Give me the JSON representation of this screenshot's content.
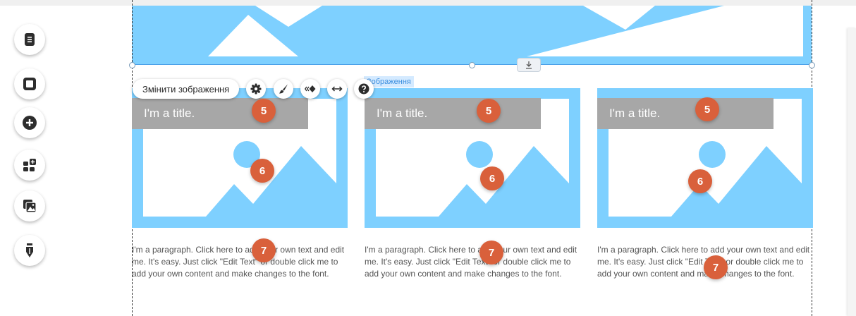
{
  "toolbar": {
    "change_image_label": "Змінити зображення",
    "image_tag": "Зображення",
    "icons": [
      "gear-icon",
      "brush-icon",
      "animation-icon",
      "stretch-icon",
      "help-icon"
    ]
  },
  "left_tools": [
    "pages-icon",
    "background-icon",
    "add-icon",
    "app-market-icon",
    "media-icon",
    "blog-icon"
  ],
  "cards": [
    {
      "title": "I'm a title.",
      "paragraph": "I'm a paragraph. Click here to add your own text and edit me. It's easy. Just click \"Edit Text\" or double click me to add your own content and make changes to the font."
    },
    {
      "title": "I'm a title.",
      "paragraph": "I'm a paragraph. Click here to add your own text and edit me. It's easy. Just click \"Edit Text\" or double click me to add your own content and make changes to the font."
    },
    {
      "title": "I'm a title.",
      "paragraph": "I'm a paragraph. Click here to add your own text and edit me. It's easy. Just click \"Edit Text\" or double click me to add your own content and make changes to the font."
    }
  ],
  "markers": {
    "title": "5",
    "image": "6",
    "paragraph": "7"
  },
  "colors": {
    "placeholder_blue": "#7ed0ff",
    "title_bg": "#a7a7a7",
    "marker": "#d9603b",
    "selection": "#4a9fe8"
  }
}
